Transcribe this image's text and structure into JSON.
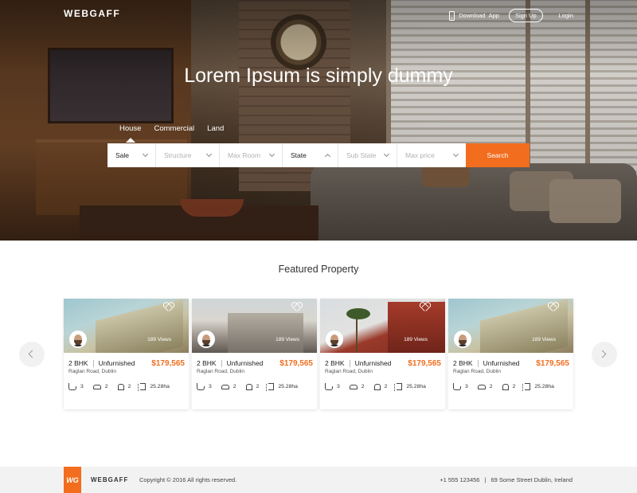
{
  "header": {
    "brand": "WEBGAFF",
    "download_label": "Download",
    "app_label": "App",
    "signup_label": "Sign Up",
    "login_label": "Login"
  },
  "hero": {
    "title": "Lorem Ipsum is simply dummy",
    "tabs": [
      {
        "label": "House",
        "active": true
      },
      {
        "label": "Commercial",
        "active": false
      },
      {
        "label": "Land",
        "active": false
      }
    ],
    "search": {
      "fields": [
        {
          "label": "Sale",
          "selected": true
        },
        {
          "label": "Structure",
          "selected": false
        },
        {
          "label": "Max Room",
          "selected": false
        },
        {
          "label": "State",
          "selected": true
        },
        {
          "label": "Sub State",
          "selected": false
        },
        {
          "label": "Max price",
          "selected": false
        }
      ],
      "button_label": "Search"
    }
  },
  "featured": {
    "title": "Featured Property",
    "cards": [
      {
        "bhk": "2 BHK",
        "furnish": "Unfurnished",
        "price": "$179,565",
        "address": "Raglan Road, Dublin",
        "views": "189 Views",
        "baths": "3",
        "cars": "2",
        "beds": "2",
        "area": "25.28ha"
      },
      {
        "bhk": "2 BHK",
        "furnish": "Unfurnished",
        "price": "$179,565",
        "address": "Raglan Road, Dublin",
        "views": "189 Views",
        "baths": "3",
        "cars": "2",
        "beds": "2",
        "area": "25.28ha"
      },
      {
        "bhk": "2 BHK",
        "furnish": "Unfurnished",
        "price": "$179,565",
        "address": "Raglan Road, Dublin",
        "views": "189 Views",
        "baths": "3",
        "cars": "2",
        "beds": "2",
        "area": "25.28ha"
      },
      {
        "bhk": "2 BHK",
        "furnish": "Unfurnished",
        "price": "$179,565",
        "address": "Raglan Road, Dublin",
        "views": "189 Views",
        "baths": "3",
        "cars": "2",
        "beds": "2",
        "area": "25.28ha"
      }
    ]
  },
  "footer": {
    "logo_text": "WG",
    "brand": "WEBGAFF",
    "copyright": "Copyright © 2016 All rights reserved.",
    "phone": "+1 555 123456",
    "separator": "|",
    "address": "69 Some Street Dublin, Ireland"
  },
  "colors": {
    "accent": "#f26d1d",
    "footer_bg": "#f2f2f2"
  },
  "icons": [
    "phone-icon",
    "chevron-down-icon",
    "chevron-up-icon",
    "heart-icon",
    "bathtub-icon",
    "car-icon",
    "bed-icon",
    "area-icon",
    "chevron-left-icon",
    "chevron-right-icon"
  ]
}
